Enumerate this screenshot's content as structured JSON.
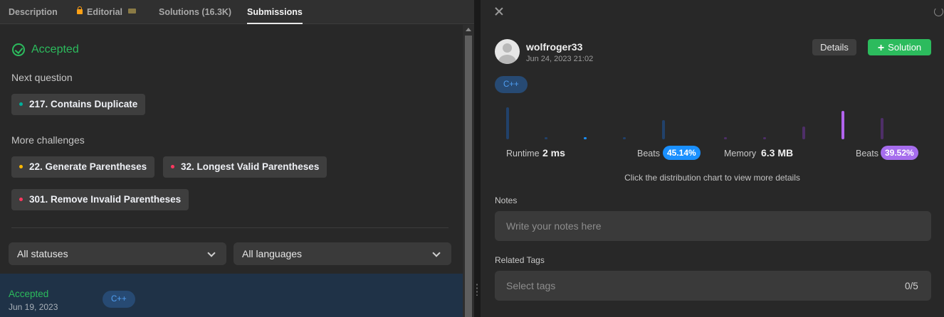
{
  "tabs": [
    {
      "label": "Description"
    },
    {
      "label": "Editorial"
    },
    {
      "label": "Solutions (16.3K)"
    },
    {
      "label": "Submissions"
    }
  ],
  "result": {
    "status": "Accepted"
  },
  "next_question": {
    "heading": "Next question",
    "items": [
      {
        "label": "217. Contains Duplicate",
        "difficulty_color": "#00af9b"
      }
    ]
  },
  "more_challenges": {
    "heading": "More challenges",
    "items": [
      {
        "label": "22. Generate Parentheses",
        "difficulty_color": "#ffb800"
      },
      {
        "label": "32. Longest Valid Parentheses",
        "difficulty_color": "#ff375f"
      },
      {
        "label": "301. Remove Invalid Parentheses",
        "difficulty_color": "#ff375f"
      }
    ]
  },
  "filters": {
    "status": "All statuses",
    "language": "All languages"
  },
  "submissions": [
    {
      "status": "Accepted",
      "date": "Jun 19, 2023",
      "language": "C++"
    }
  ],
  "detail": {
    "username": "wolfroger33",
    "datetime": "Jun 24, 2023 21:02",
    "details_label": "Details",
    "solution_label": "Solution",
    "language": "C++",
    "runtime": {
      "label": "Runtime",
      "value": "2 ms",
      "beats_label": "Beats",
      "beats": "45.14%",
      "color": "#1a90ff"
    },
    "memory": {
      "label": "Memory",
      "value": "6.3 MB",
      "beats_label": "Beats",
      "beats": "39.52%",
      "color": "#a66ded"
    },
    "hint": "Click the distribution chart to view more details",
    "notes": {
      "label": "Notes",
      "placeholder": "Write your notes here"
    },
    "tags": {
      "label": "Related Tags",
      "placeholder": "Select tags",
      "count": "0/5"
    }
  },
  "distribution": {
    "runtime_bars": [
      {
        "level": 0.98,
        "highlight": false
      },
      {
        "level": 0.05,
        "highlight": false
      },
      {
        "level": 0.05,
        "highlight": true
      },
      {
        "level": 0.05,
        "highlight": false
      },
      {
        "level": 0.58,
        "highlight": false
      }
    ],
    "memory_bars": [
      {
        "level": 0.05,
        "highlight": false
      },
      {
        "level": 0.05,
        "highlight": false
      },
      {
        "level": 0.4,
        "highlight": false
      },
      {
        "level": 0.88,
        "highlight": true
      },
      {
        "level": 0.66,
        "highlight": false
      }
    ]
  }
}
